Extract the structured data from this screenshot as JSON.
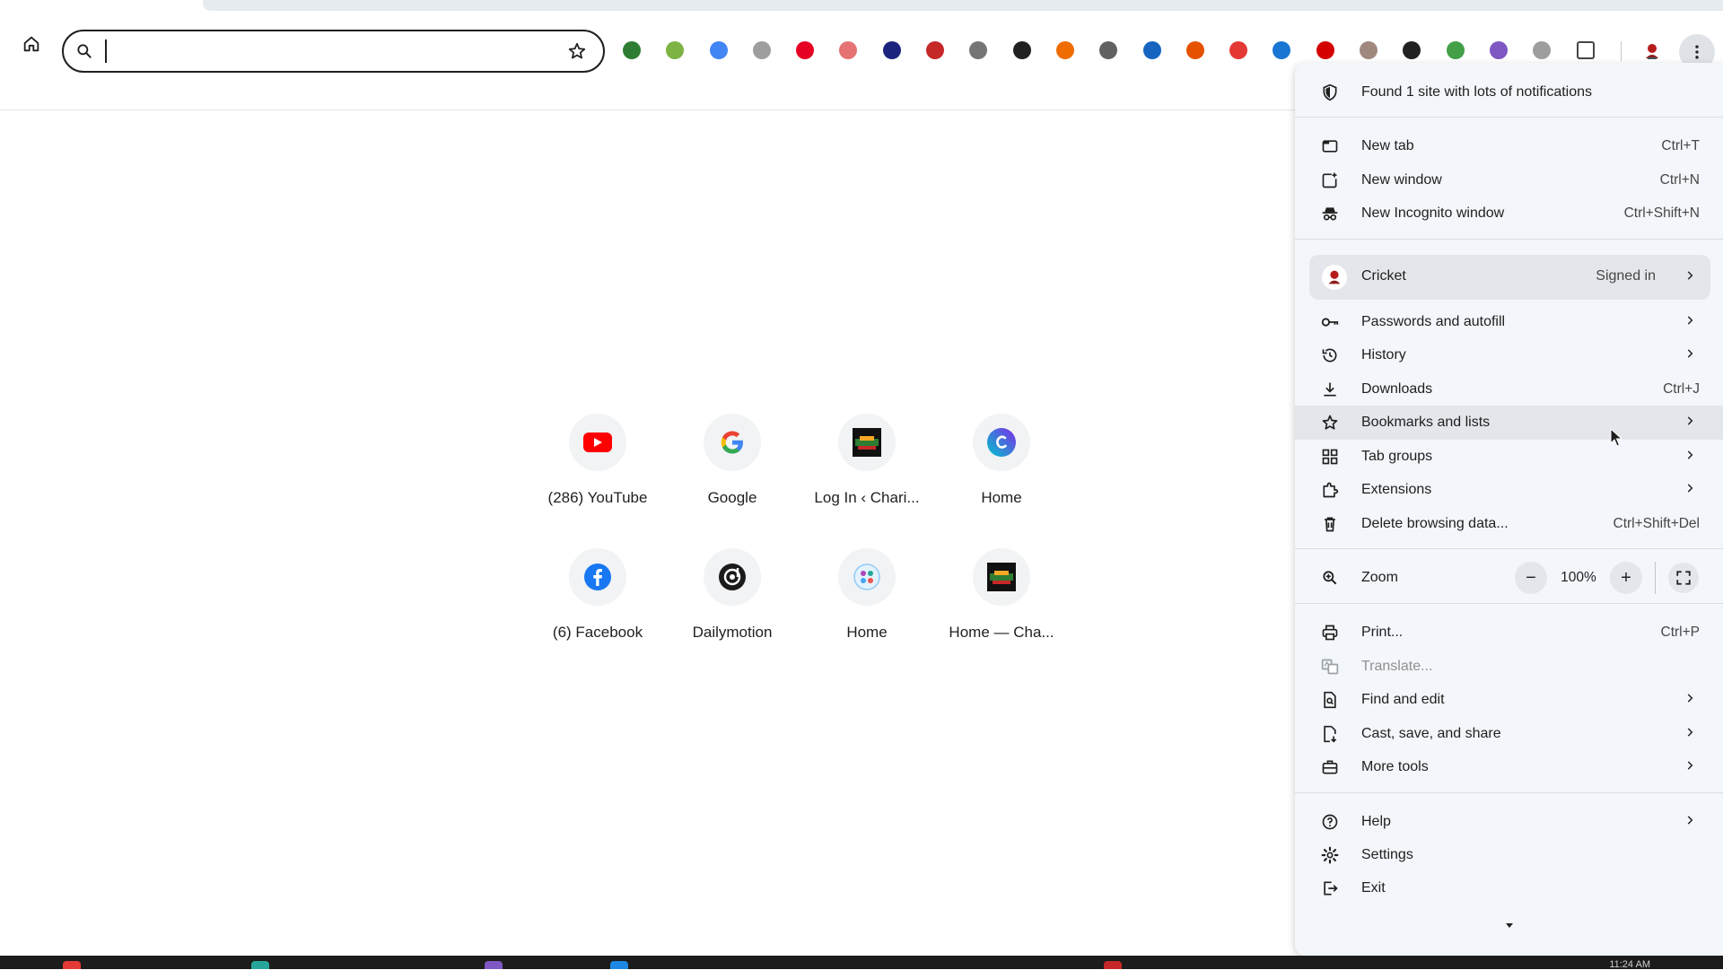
{
  "colors": {
    "accent": "#0b57d0",
    "menu_bg": "#f3f6fa",
    "hover": "#e3e7eb"
  },
  "omnibox": {
    "value": "",
    "search_icon": "search-icon",
    "bookmark_icon": "star-icon"
  },
  "extensions": [
    {
      "name": "globe-extension-icon",
      "color": "#2e7d32"
    },
    {
      "name": "gear-leaf-extension-icon",
      "color": "#7cb342"
    },
    {
      "name": "translate-extension-icon",
      "color": "#4285f4"
    },
    {
      "name": "world-extension-icon",
      "color": "#9e9e9e"
    },
    {
      "name": "pinterest-extension-icon",
      "color": "#e60023"
    },
    {
      "name": "camera-extension-icon",
      "color": "#e57373"
    },
    {
      "name": "waveform-extension-icon",
      "color": "#1a237e"
    },
    {
      "name": "stamp-extension-icon",
      "color": "#c62828"
    },
    {
      "name": "grammar-extension-icon",
      "color": "#757575"
    },
    {
      "name": "moon-extension-icon",
      "color": "#212121"
    },
    {
      "name": "chart-extension-icon",
      "color": "#ef6c00"
    },
    {
      "name": "robot-extension-icon",
      "color": "#616161"
    },
    {
      "name": "iq-extension-icon",
      "color": "#1565c0"
    },
    {
      "name": "chess-extension-icon",
      "color": "#e65100"
    },
    {
      "name": "speed-extension-icon",
      "color": "#e53935"
    },
    {
      "name": "audio-extension-icon",
      "color": "#1976d2"
    },
    {
      "name": "v-extension-icon",
      "color": "#d50000"
    },
    {
      "name": "cookie-extension-icon",
      "color": "#a1887f"
    },
    {
      "name": "dark-square-extension-icon",
      "color": "#212121"
    },
    {
      "name": "hex-extension-icon",
      "color": "#43a047"
    },
    {
      "name": "pen-extension-icon",
      "color": "#7e57c2"
    },
    {
      "name": "record-extension-icon",
      "color": "#9e9e9e"
    },
    {
      "name": "puzzle-extension-icon",
      "color": "#444746"
    }
  ],
  "shortcuts": [
    {
      "label": "(286) YouTube",
      "icon": "youtube-icon"
    },
    {
      "label": "Google",
      "icon": "google-icon"
    },
    {
      "label": "Log In ‹ Chari...",
      "icon": "site-thumbnail-icon"
    },
    {
      "label": "Home",
      "icon": "canva-icon"
    },
    {
      "label": "(6) Facebook",
      "icon": "facebook-icon"
    },
    {
      "label": "Dailymotion",
      "icon": "dailymotion-icon"
    },
    {
      "label": "Home",
      "icon": "globe-logo-icon"
    },
    {
      "label": "Home — Cha...",
      "icon": "site-thumbnail-icon"
    }
  ],
  "menu": {
    "notification": "Found 1 site with lots of notifications",
    "new_tab": {
      "label": "New tab",
      "shortcut": "Ctrl+T"
    },
    "new_window": {
      "label": "New window",
      "shortcut": "Ctrl+N"
    },
    "new_incognito": {
      "label": "New Incognito window",
      "shortcut": "Ctrl+Shift+N"
    },
    "profile": {
      "name": "Cricket",
      "status": "Signed in"
    },
    "passwords": {
      "label": "Passwords and autofill"
    },
    "history": {
      "label": "History"
    },
    "downloads": {
      "label": "Downloads",
      "shortcut": "Ctrl+J"
    },
    "bookmarks": {
      "label": "Bookmarks and lists"
    },
    "tab_groups": {
      "label": "Tab groups"
    },
    "extensions": {
      "label": "Extensions"
    },
    "delete_data": {
      "label": "Delete browsing data...",
      "shortcut": "Ctrl+Shift+Del"
    },
    "zoom": {
      "label": "Zoom",
      "value": "100%",
      "minus": "−",
      "plus": "+"
    },
    "print": {
      "label": "Print...",
      "shortcut": "Ctrl+P"
    },
    "translate": {
      "label": "Translate..."
    },
    "find_edit": {
      "label": "Find and edit"
    },
    "cast_save": {
      "label": "Cast, save, and share"
    },
    "more_tools": {
      "label": "More tools"
    },
    "help": {
      "label": "Help"
    },
    "settings": {
      "label": "Settings"
    },
    "exit": {
      "label": "Exit"
    }
  },
  "taskbar": {
    "clock": "11:24 AM"
  }
}
